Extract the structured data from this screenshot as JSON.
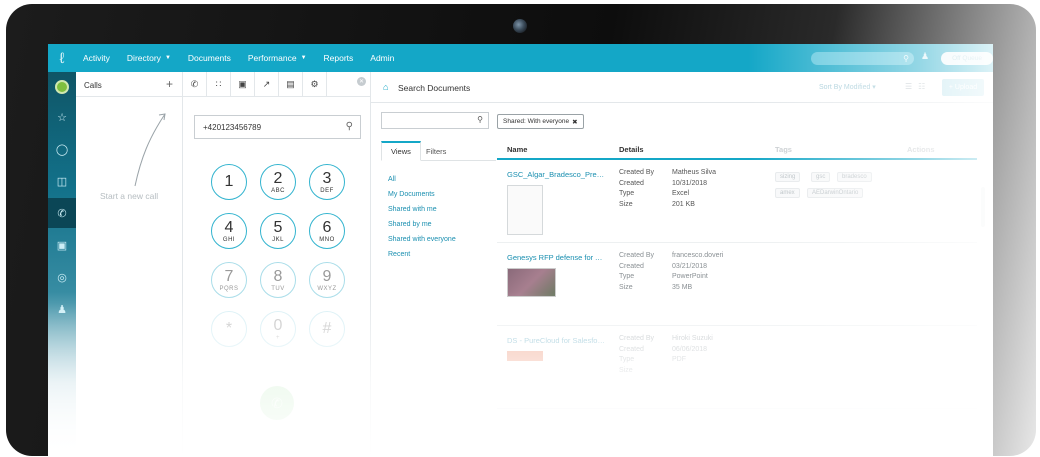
{
  "nav": {
    "items": [
      {
        "label": "Activity",
        "caret": false
      },
      {
        "label": "Directory",
        "caret": true
      },
      {
        "label": "Documents",
        "caret": false
      },
      {
        "label": "Performance",
        "caret": true
      },
      {
        "label": "Reports",
        "caret": false
      },
      {
        "label": "Admin",
        "caret": false
      }
    ],
    "status": "Off Queue"
  },
  "calls": {
    "title": "Calls",
    "add_symbol": "+",
    "new_call_hint": "Start a new call"
  },
  "dialer": {
    "number": "+420123456789",
    "keys": [
      {
        "digit": "1",
        "letters": ""
      },
      {
        "digit": "2",
        "letters": "ABC"
      },
      {
        "digit": "3",
        "letters": "DEF"
      },
      {
        "digit": "4",
        "letters": "GHI"
      },
      {
        "digit": "5",
        "letters": "JKL"
      },
      {
        "digit": "6",
        "letters": "MNO"
      },
      {
        "digit": "7",
        "letters": "PQRS"
      },
      {
        "digit": "8",
        "letters": "TUV"
      },
      {
        "digit": "9",
        "letters": "WXYZ"
      },
      {
        "digit": "*",
        "letters": ""
      },
      {
        "digit": "0",
        "letters": "+"
      },
      {
        "digit": "#",
        "letters": ""
      }
    ]
  },
  "documents": {
    "title": "Search Documents",
    "sort_label": "Sort By Modified",
    "upload_label": "Upload",
    "filter_chip": "Shared: With everyone",
    "tabs": {
      "views": "Views",
      "filters": "Filters"
    },
    "views": [
      "All",
      "My Documents",
      "Shared with me",
      "Shared by me",
      "Shared with everyone",
      "Recent"
    ],
    "columns": {
      "name": "Name",
      "details": "Details",
      "tags": "Tags",
      "actions": "Actions"
    },
    "detail_labels": {
      "created_by": "Created By",
      "created": "Created",
      "type": "Type",
      "size": "Size"
    },
    "rows": [
      {
        "name": "GSC_Algar_Bradesco_Premis...",
        "created_by": "Matheus Silva",
        "created": "10/31/2018",
        "type": "Excel",
        "size": "201 KB",
        "tags": [
          "sizing",
          "gsc",
          "bradesco",
          "amex",
          "AEDarwinOntario"
        ]
      },
      {
        "name": "Genesys RFP defense for Ago...",
        "created_by": "francesco.doveri",
        "created": "03/21/2018",
        "type": "PowerPoint",
        "size": "35 MB",
        "tags": []
      },
      {
        "name": "DS - PureCloud for Salesforce...",
        "created_by": "Hiroki Suzuki",
        "created": "06/06/2018",
        "type": "PDF",
        "size": "",
        "tags": []
      }
    ]
  }
}
